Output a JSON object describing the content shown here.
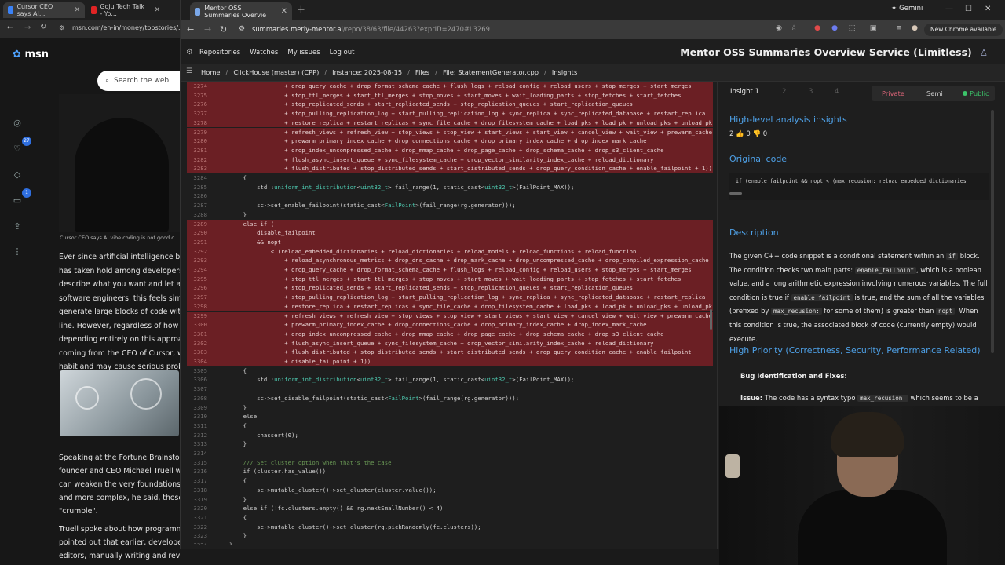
{
  "background_browser": {
    "tabs": [
      {
        "label": "Cursor CEO says AI..."
      },
      {
        "label": "Goju Tech Talk - Yo..."
      }
    ],
    "url": "msn.com/en-in/money/topstories/...",
    "logo": "msn",
    "search_placeholder": "Search the web",
    "rail_badges": [
      "27",
      "1"
    ],
    "hero_caption": "Cursor CEO says AI vibe coding is not good c",
    "article_lines": [
      "Ever since artificial intelligence beca",
      "has taken hold among developers:",
      "describe what you want and let an",
      "software engineers, this feels simpl",
      "generate large blocks of code with",
      "line. However, regardless of how m",
      "depending entirely on this approac",
      "coming from the CEO of Cursor, wh",
      "habit and may cause serious proble"
    ],
    "article2_lines": [
      "Speaking at the Fortune Brainstorm",
      "founder and CEO Michael Truell wa",
      "can weaken the very foundations o",
      "and more complex, he said, those w",
      "\"crumble\".",
      "",
      "Truell spoke about how programmi",
      "pointed out that earlier, developers",
      "editors, manually writing and revie"
    ]
  },
  "browser": {
    "tab_title": "Mentor OSS Summaries Overvie",
    "gemini_label": "Gemini",
    "url_host": "summaries.merly-mentor.ai",
    "url_path": "/repo/38/63/file/44263?exprID=2470#L3269",
    "new_chrome_label": "New Chrome available"
  },
  "app": {
    "nav": [
      "Repositories",
      "Watches",
      "My issues",
      "Log out"
    ],
    "title": "Mentor OSS Summaries Overview Service (Limitless)",
    "breadcrumb": [
      "Home",
      "ClickHouse (master) (CPP)",
      "Instance: 2025-08-15",
      "Files",
      "File: StatementGenerator.cpp",
      "Insights"
    ]
  },
  "code": {
    "lines": [
      {
        "n": "3274",
        "hl": true,
        "text": "                + drop_query_cache + drop_format_schema_cache + flush_logs + reload_config + reload_users + stop_merges + start_merges"
      },
      {
        "n": "3275",
        "hl": true,
        "text": "                + stop_ttl_merges + start_ttl_merges + stop_moves + start_moves + wait_loading_parts + stop_fetches + start_fetches"
      },
      {
        "n": "3276",
        "hl": true,
        "text": "                + stop_replicated_sends + start_replicated_sends + stop_replication_queues + start_replication_queues"
      },
      {
        "n": "3277",
        "hl": true,
        "text": "                + stop_pulling_replication_log + start_pulling_replication_log + sync_replica + sync_replicated_database + restart_replica"
      },
      {
        "n": "3278",
        "hl": true,
        "text": "                + restore_replica + restart_replicas + sync_file_cache + drop_filesystem_cache + load_pks + load_pk + unload_pks + unload_pk"
      },
      {
        "n": "3279",
        "hl": true,
        "text": "                + refresh_views + refresh_view + stop_views + stop_view + start_views + start_view + cancel_view + wait_view + prewarm_cache"
      },
      {
        "n": "3280",
        "hl": true,
        "text": "                + prewarm_primary_index_cache + drop_connections_cache + drop_primary_index_cache + drop_index_mark_cache"
      },
      {
        "n": "3281",
        "hl": true,
        "text": "                + drop_index_uncompressed_cache + drop_mmap_cache + drop_page_cache + drop_schema_cache + drop_s3_client_cache"
      },
      {
        "n": "3282",
        "hl": true,
        "text": "                + flush_async_insert_queue + sync_filesystem_cache + drop_vector_similarity_index_cache + reload_dictionary"
      },
      {
        "n": "3283",
        "hl": true,
        "text": "                + flush_distributed + stop_distributed_sends + start_distributed_sends + drop_query_condition_cache + enable_failpoint + 1))"
      },
      {
        "n": "3284",
        "hl": false,
        "text": "    {"
      },
      {
        "n": "3285",
        "hl": false,
        "text": "        std::uniform_int_distribution<uint32_t> fail_range(1, static_cast<uint32_t>(FailPoint_MAX));"
      },
      {
        "n": "3286",
        "hl": false,
        "text": ""
      },
      {
        "n": "3287",
        "hl": false,
        "text": "        sc->set_enable_failpoint(static_cast<FailPoint>(fail_range(rg.generator)));"
      },
      {
        "n": "3288",
        "hl": false,
        "text": "    }"
      },
      {
        "n": "3289",
        "hl": true,
        "text": "    else if ("
      },
      {
        "n": "3290",
        "hl": true,
        "text": "        disable_failpoint"
      },
      {
        "n": "3291",
        "hl": true,
        "text": "        && nopt"
      },
      {
        "n": "3292",
        "hl": true,
        "text": "            < (reload_embedded_dictionaries + reload_dictionaries + reload_models + reload_functions + reload_function"
      },
      {
        "n": "3293",
        "hl": true,
        "text": "                + reload_asynchronous_metrics + drop_dns_cache + drop_mark_cache + drop_uncompressed_cache + drop_compiled_expression_cache"
      },
      {
        "n": "3294",
        "hl": true,
        "text": "                + drop_query_cache + drop_format_schema_cache + flush_logs + reload_config + reload_users + stop_merges + start_merges"
      },
      {
        "n": "3295",
        "hl": true,
        "text": "                + stop_ttl_merges + start_ttl_merges + stop_moves + start_moves + wait_loading_parts + stop_fetches + start_fetches"
      },
      {
        "n": "3296",
        "hl": true,
        "text": "                + stop_replicated_sends + start_replicated_sends + stop_replication_queues + start_replication_queues"
      },
      {
        "n": "3297",
        "hl": true,
        "text": "                + stop_pulling_replication_log + start_pulling_replication_log + sync_replica + sync_replicated_database + restart_replica"
      },
      {
        "n": "3298",
        "hl": true,
        "text": "                + restore_replica + restart_replicas + sync_file_cache + drop_filesystem_cache + load_pks + load_pk + unload_pks + unload_pk"
      },
      {
        "n": "3299",
        "hl": true,
        "text": "                + refresh_views + refresh_view + stop_views + stop_view + start_views + start_view + cancel_view + wait_view + prewarm_cache"
      },
      {
        "n": "3300",
        "hl": true,
        "text": "                + prewarm_primary_index_cache + drop_connections_cache + drop_primary_index_cache + drop_index_mark_cache"
      },
      {
        "n": "3301",
        "hl": true,
        "text": "                + drop_index_uncompressed_cache + drop_mmap_cache + drop_page_cache + drop_schema_cache + drop_s3_client_cache"
      },
      {
        "n": "3302",
        "hl": true,
        "text": "                + flush_async_insert_queue + sync_filesystem_cache + drop_vector_similarity_index_cache + reload_dictionary"
      },
      {
        "n": "3303",
        "hl": true,
        "text": "                + flush_distributed + stop_distributed_sends + start_distributed_sends + drop_query_condition_cache + enable_failpoint"
      },
      {
        "n": "3304",
        "hl": true,
        "text": "                + disable_failpoint + 1))"
      },
      {
        "n": "3305",
        "hl": false,
        "text": "    {"
      },
      {
        "n": "3306",
        "hl": false,
        "text": "        std::uniform_int_distribution<uint32_t> fail_range(1, static_cast<uint32_t>(FailPoint_MAX));"
      },
      {
        "n": "3307",
        "hl": false,
        "text": ""
      },
      {
        "n": "3308",
        "hl": false,
        "text": "        sc->set_disable_failpoint(static_cast<FailPoint>(fail_range(rg.generator)));"
      },
      {
        "n": "3309",
        "hl": false,
        "text": "    }"
      },
      {
        "n": "3310",
        "hl": false,
        "text": "    else"
      },
      {
        "n": "3311",
        "hl": false,
        "text": "    {"
      },
      {
        "n": "3312",
        "hl": false,
        "text": "        chassert(0);"
      },
      {
        "n": "3313",
        "hl": false,
        "text": "    }"
      },
      {
        "n": "3314",
        "hl": false,
        "text": ""
      },
      {
        "n": "3315",
        "hl": false,
        "text": "    /// Set cluster option when that's the case"
      },
      {
        "n": "3316",
        "hl": false,
        "text": "    if (cluster.has_value())"
      },
      {
        "n": "3317",
        "hl": false,
        "text": "    {"
      },
      {
        "n": "3318",
        "hl": false,
        "text": "        sc->mutable_cluster()->set_cluster(cluster.value());"
      },
      {
        "n": "3319",
        "hl": false,
        "text": "    }"
      },
      {
        "n": "3320",
        "hl": false,
        "text": "    else if (!fc.clusters.empty() && rg.nextSmallNumber() < 4)"
      },
      {
        "n": "3321",
        "hl": false,
        "text": "    {"
      },
      {
        "n": "3322",
        "hl": false,
        "text": "        sc->mutable_cluster()->set_cluster(rg.pickRandomly(fc.clusters));"
      },
      {
        "n": "3323",
        "hl": false,
        "text": "    }"
      },
      {
        "n": "3324",
        "hl": false,
        "text": "}"
      }
    ]
  },
  "insights": {
    "tabs": [
      "Insight 1",
      "2",
      "3",
      "4"
    ],
    "visibility": {
      "private": "Private",
      "semi": "Semi",
      "public": "Public"
    },
    "heading_high": "High-level analysis insights",
    "votes": "2 👍 0 👎 0",
    "heading_original": "Original code",
    "original_code": "if (enable_failpoint && nopt < (max_recusion: reload_embedded_dictionaries",
    "heading_description": "Description",
    "desc": {
      "p1": "The given C++ code snippet is a conditional statement within an",
      "c1": "if",
      "p2": "block. The condition checks two main parts:",
      "c2": "enable_failpoint",
      "p3": ", which is a boolean value, and a long arithmetic expression involving numerous variables. The full condition is true if",
      "c3": "enable_failpoint",
      "p4": "is true, and the sum of all the variables (prefixed by",
      "c4": "max_recusion:",
      "p5": "for some of them) is greater than",
      "c5": "nopt",
      "p6": ". When this condition is true, the associated block of code (currently empty) would execute."
    },
    "heading_priority": "High Priority (Correctness, Security, Performance Related)",
    "bug_heading": "Bug Identification and Fixes:",
    "issue_label": "Issue:",
    "issue_text_a": "The code has a syntax typo",
    "issue_code": "max_recusion:",
    "issue_text_b": "which seems to be a"
  },
  "colors": {
    "link_blue": "#4ea0e6",
    "highlight_red": "#6b1f24",
    "private": "#e0667a",
    "public": "#3cc46a"
  }
}
